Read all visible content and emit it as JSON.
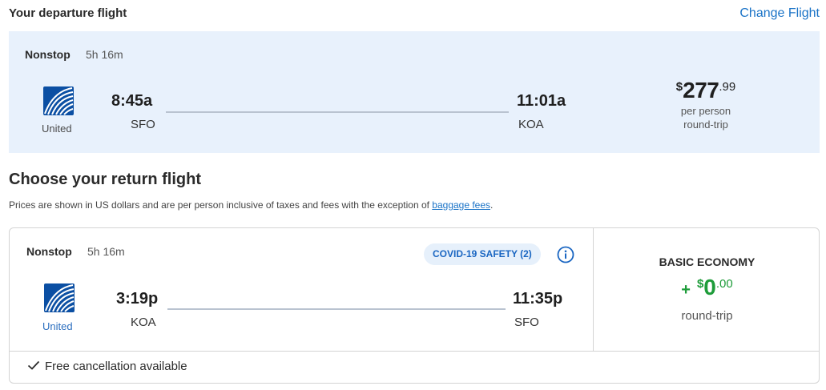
{
  "departure": {
    "title": "Your departure flight",
    "change_label": "Change Flight",
    "nonstop": "Nonstop",
    "duration": "5h 16m",
    "airline": "United",
    "depart_time": "8:45a",
    "depart_code": "SFO",
    "arrive_time": "11:01a",
    "arrive_code": "KOA",
    "price_symbol": "$",
    "price_whole": "277",
    "price_cents": ".99",
    "price_line1": "per person",
    "price_line2": "round-trip"
  },
  "return_section": {
    "title": "Choose your return flight",
    "disclaimer": "Prices are shown in US dollars and are per person inclusive of taxes and fees with the exception of ",
    "baggage_link": "baggage fees",
    "disclaimer_end": "."
  },
  "return_flight": {
    "nonstop": "Nonstop",
    "duration": "5h 16m",
    "covid_badge": "COVID-19 SAFETY (2)",
    "airline": "United",
    "depart_time": "3:19p",
    "depart_code": "KOA",
    "arrive_time": "11:35p",
    "arrive_code": "SFO",
    "fare_name": "BASIC ECONOMY",
    "fare_plus": "+",
    "fare_symbol": "$",
    "fare_whole": "0",
    "fare_cents": ".00",
    "fare_sub": "round-trip",
    "cancellation": "Free cancellation available"
  },
  "colors": {
    "accent_blue": "#1a73c7",
    "card_bg": "#e8f1fc",
    "price_green": "#1e9c3a",
    "united_blue": "#0b4fa3"
  },
  "icons": [
    "united-logo-icon",
    "info-icon",
    "check-icon"
  ]
}
